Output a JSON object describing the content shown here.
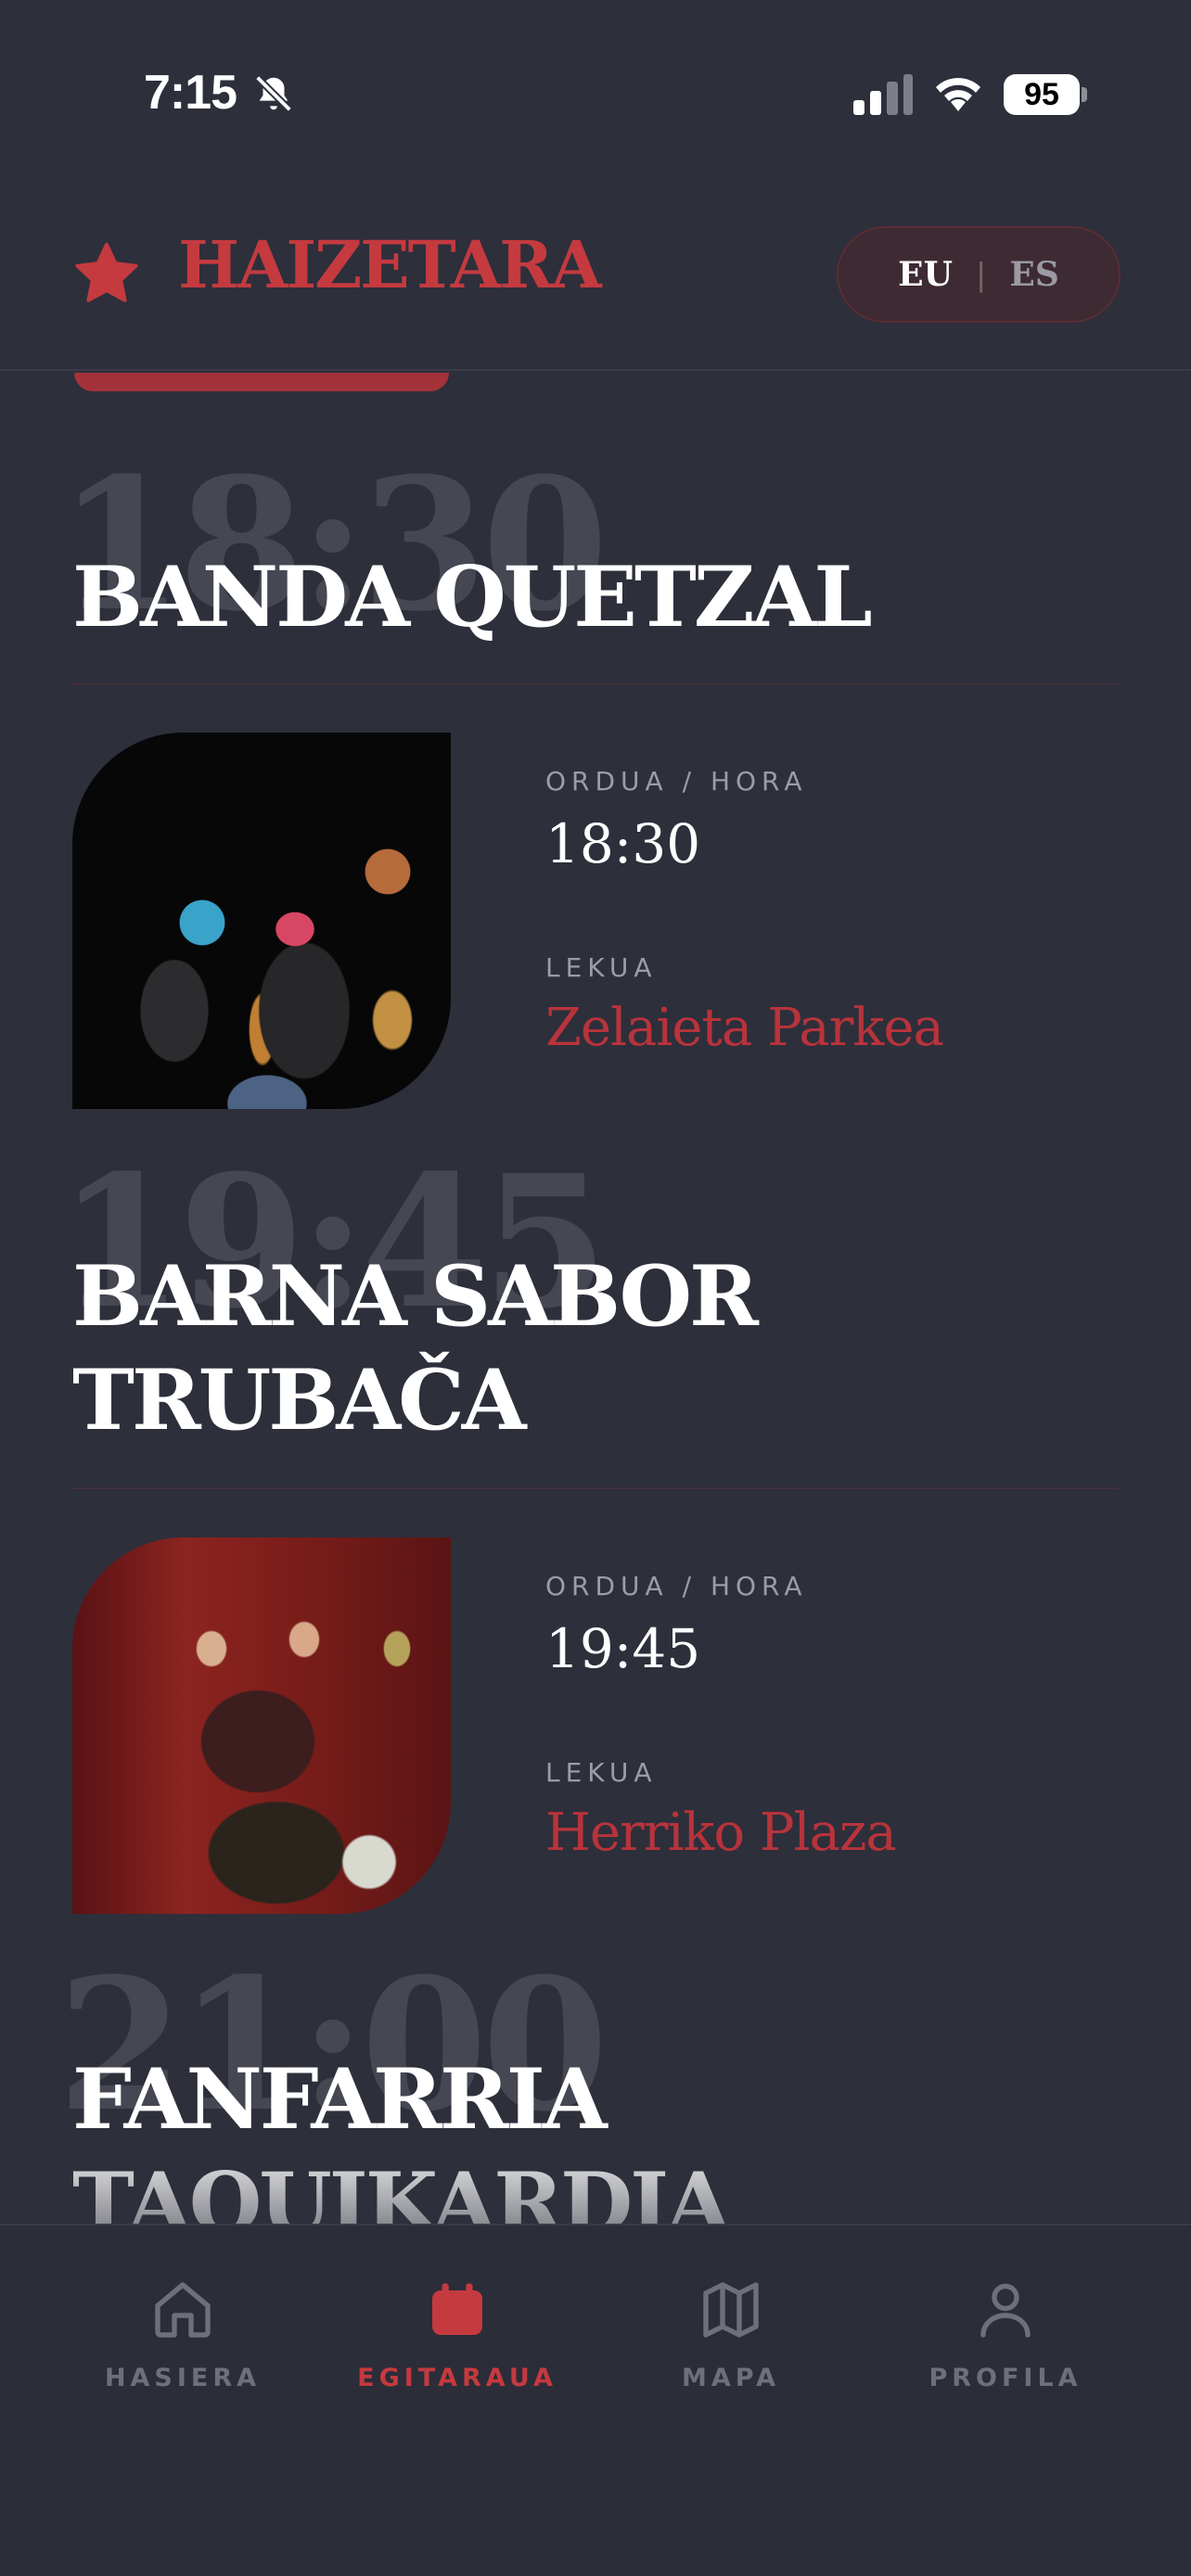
{
  "status_bar": {
    "time": "7:15",
    "battery": "95",
    "icons": [
      "bell-slash-icon",
      "cellular-signal-icon",
      "wifi-icon",
      "battery-icon"
    ]
  },
  "header": {
    "logo_text": "HAIZETARA",
    "logo_icon": "star-icon",
    "language_switch": {
      "active": "EU",
      "separator": "|",
      "inactive": "ES"
    }
  },
  "labels": {
    "time_label": "ORDUA / HORA",
    "venue_label": "LEKUA"
  },
  "events": [
    {
      "big_time": "18:30",
      "title": "BANDA QUETZAL",
      "time": "18:30",
      "venue": "Zelaieta Parkea"
    },
    {
      "big_time": "19:45",
      "title": "BARNA SABOR TRUBAČA",
      "title_line1": "BARNA SABOR",
      "title_line2": "TRUBAČA",
      "time": "19:45",
      "venue": "Herriko Plaza"
    },
    {
      "big_time": "21:00",
      "title_line1": "FANFARRIA",
      "title_line2": "TAQUIKARDIA"
    }
  ],
  "bottom_nav": {
    "items": [
      {
        "label": "HASIERA",
        "icon": "home-icon"
      },
      {
        "label": "EGITARAUA",
        "icon": "calendar-icon",
        "active": true
      },
      {
        "label": "MAPA",
        "icon": "map-icon"
      },
      {
        "label": "PROFILA",
        "icon": "user-icon"
      }
    ]
  },
  "colors": {
    "background": "#2d2f3b",
    "accent": "#c43a3f",
    "venue": "#b8333b",
    "muted": "#9c9ca6"
  }
}
